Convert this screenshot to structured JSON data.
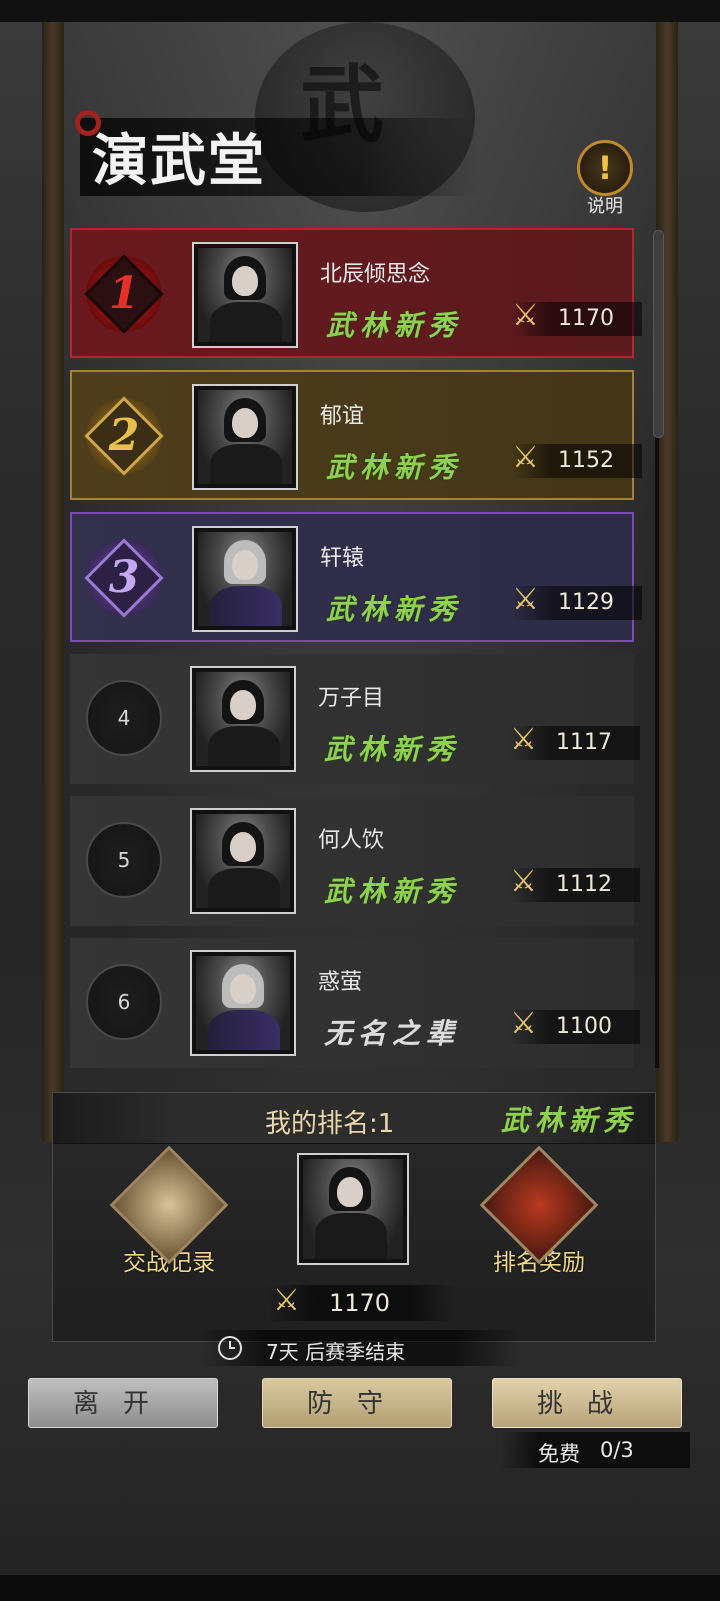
{
  "header": {
    "title": "演武堂",
    "help_label": "说明",
    "help_icon": "exclamation-icon",
    "drum_char": "武"
  },
  "ranking": [
    {
      "rank": "1",
      "name": "北辰倾思念",
      "title": "武林新秀",
      "score": "1170",
      "style": "gold-red"
    },
    {
      "rank": "2",
      "name": "郁谊",
      "title": "武林新秀",
      "score": "1152",
      "style": "gold"
    },
    {
      "rank": "3",
      "name": "轩辕",
      "title": "武林新秀",
      "score": "1129",
      "style": "purple"
    },
    {
      "rank": "4",
      "name": "万子目",
      "title": "武林新秀",
      "score": "1117",
      "style": "plain"
    },
    {
      "rank": "5",
      "name": "何人饮",
      "title": "武林新秀",
      "score": "1112",
      "style": "plain"
    },
    {
      "rank": "6",
      "name": "惑萤",
      "title": "无名之辈",
      "score": "1100",
      "style": "plain"
    }
  ],
  "my_rank": {
    "label": "我的排名:1",
    "title": "武林新秀",
    "score": "1170",
    "battle_record_label": "交战记录",
    "rank_reward_label": "排名奖励"
  },
  "season": {
    "text": "7天 后赛季结束"
  },
  "buttons": {
    "leave": "离开",
    "defend": "防守",
    "challenge": "挑战"
  },
  "free": {
    "label": "免费",
    "count": "0/3"
  },
  "colors": {
    "rank1": "#b02631",
    "rank2": "#a3823a",
    "rank3": "#7a4bb2",
    "title_green": "#8fd14f"
  }
}
